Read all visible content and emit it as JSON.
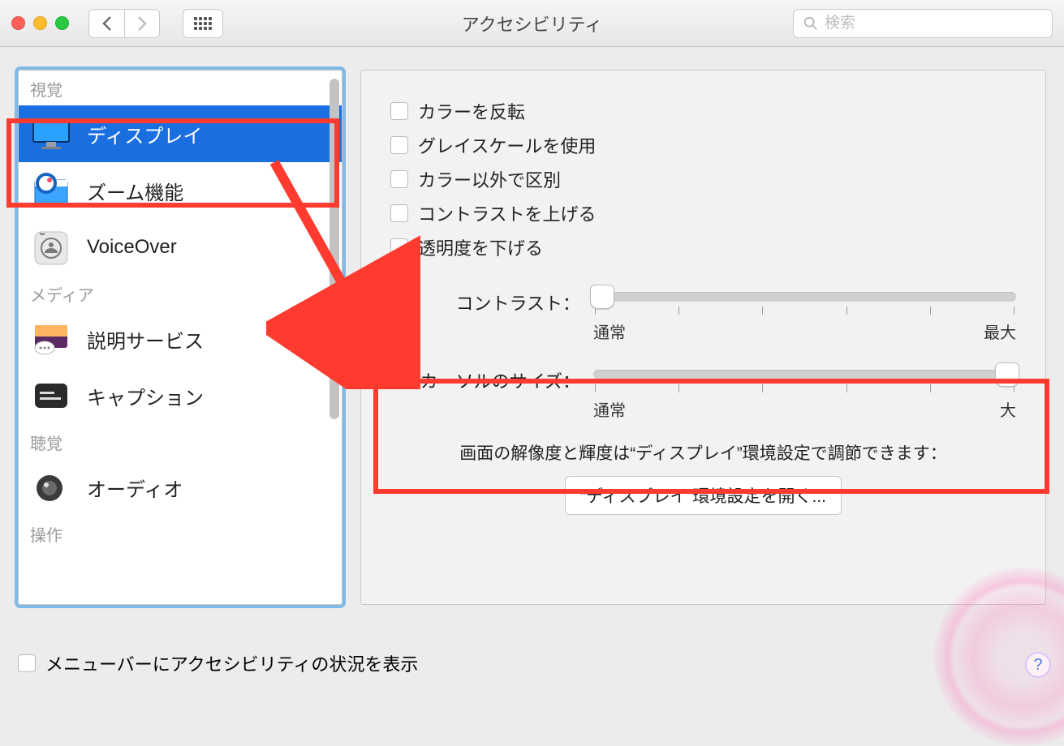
{
  "window": {
    "title": "アクセシビリティ"
  },
  "toolbar": {
    "search_placeholder": "検索"
  },
  "sidebar": {
    "sections": [
      {
        "label": "視覚",
        "items": [
          {
            "id": "display",
            "label": "ディスプレイ",
            "icon": "display-icon",
            "selected": true
          },
          {
            "id": "zoom",
            "label": "ズーム機能",
            "icon": "zoom-icon",
            "selected": false
          },
          {
            "id": "voiceover",
            "label": "VoiceOver",
            "icon": "voiceover-icon",
            "selected": false
          }
        ]
      },
      {
        "label": "メディア",
        "items": [
          {
            "id": "desc",
            "label": "説明サービス",
            "icon": "descriptions-icon",
            "selected": false
          },
          {
            "id": "captions",
            "label": "キャプション",
            "icon": "captions-icon",
            "selected": false
          }
        ]
      },
      {
        "label": "聴覚",
        "items": [
          {
            "id": "audio",
            "label": "オーディオ",
            "icon": "audio-icon",
            "selected": false
          }
        ]
      },
      {
        "label": "操作",
        "items": []
      }
    ]
  },
  "panel": {
    "checkboxes": [
      {
        "id": "invert",
        "label": "カラーを反転",
        "checked": false
      },
      {
        "id": "grayscale",
        "label": "グレイスケールを使用",
        "checked": false
      },
      {
        "id": "diffnocolor",
        "label": "カラー以外で区別",
        "checked": false
      },
      {
        "id": "contrastup",
        "label": "コントラストを上げる",
        "checked": false
      },
      {
        "id": "reducetrans",
        "label": "透明度を下げる",
        "checked": false
      }
    ],
    "sliders": {
      "contrast": {
        "label": "コントラスト：",
        "min_label": "通常",
        "max_label": "最大",
        "value_percent": 0
      },
      "cursor": {
        "label": "カーソルのサイズ：",
        "min_label": "通常",
        "max_label": "大",
        "value_percent": 100
      }
    },
    "hint": "画面の解像度と輝度は“ディスプレイ”環境設定で調節できます：",
    "open_button_label": "“ディスプレイ”環境設定を開く..."
  },
  "footer": {
    "show_status_label": "メニューバーにアクセシビリティの状況を表示"
  },
  "annotation": {
    "highlight_color": "#ff3b2f"
  }
}
